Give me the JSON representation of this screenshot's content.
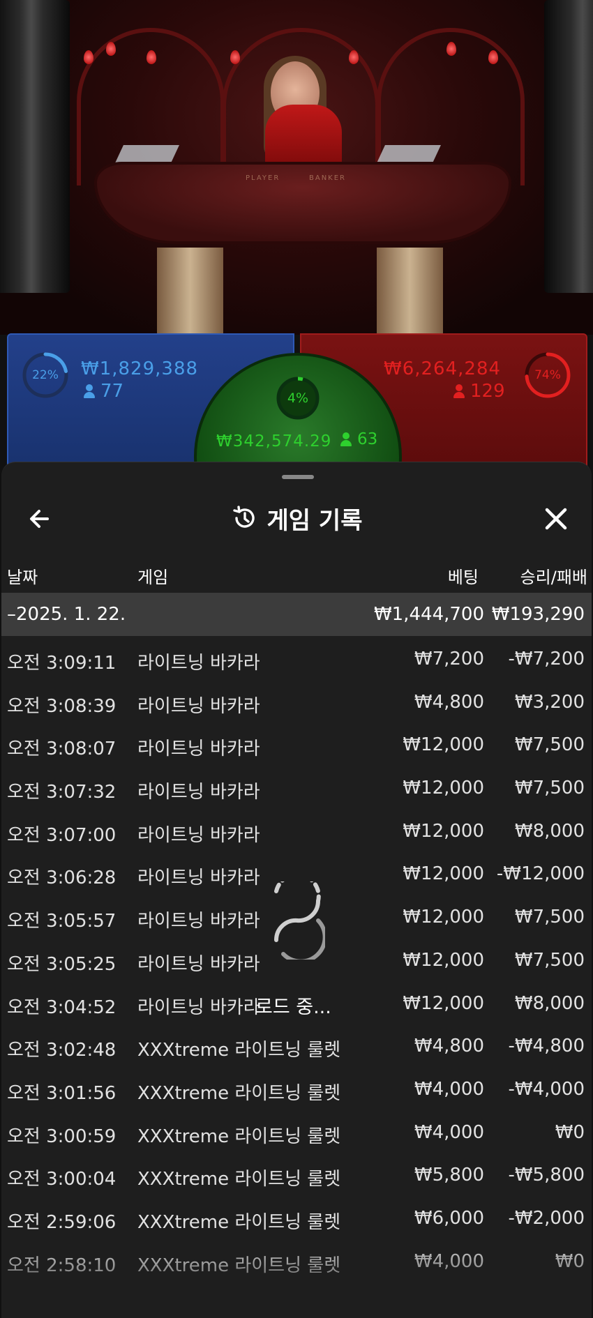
{
  "scene": {
    "table_text_left": "PLAYER",
    "table_text_right": "BANKER"
  },
  "bets": {
    "player": {
      "percent": "22%",
      "percent_value": 22,
      "amount": "₩1,829,388",
      "count": "77",
      "color": "#4a9fe8"
    },
    "banker": {
      "percent": "74%",
      "percent_value": 74,
      "amount": "₩6,264,284",
      "count": "129",
      "color": "#e22020"
    },
    "tie": {
      "percent": "4%",
      "percent_value": 4,
      "amount": "₩342,574.29",
      "count": "63",
      "color": "#2ed02e"
    }
  },
  "sheet": {
    "title": "게임 기록",
    "icons": {
      "back": "arrow-left-icon",
      "history": "history-icon",
      "close": "close-icon"
    },
    "columns": {
      "date": "날짜",
      "game": "게임",
      "bet": "베팅",
      "win_loss": "승리/패배"
    },
    "date_group": {
      "date": "–2025. 1. 22.",
      "bet_total": "₩1,444,700",
      "win_total": "₩193,290"
    },
    "rows": [
      {
        "time": "오전 3:09:11",
        "game": "라이트닝 바카라",
        "bet": "₩7,200",
        "result": "-₩7,200"
      },
      {
        "time": "오전 3:08:39",
        "game": "라이트닝 바카라",
        "bet": "₩4,800",
        "result": "₩3,200"
      },
      {
        "time": "오전 3:08:07",
        "game": "라이트닝 바카라",
        "bet": "₩12,000",
        "result": "₩7,500"
      },
      {
        "time": "오전 3:07:32",
        "game": "라이트닝 바카라",
        "bet": "₩12,000",
        "result": "₩7,500"
      },
      {
        "time": "오전 3:07:00",
        "game": "라이트닝 바카라",
        "bet": "₩12,000",
        "result": "₩8,000"
      },
      {
        "time": "오전 3:06:28",
        "game": "라이트닝 바카라",
        "bet": "₩12,000",
        "result": "-₩12,000"
      },
      {
        "time": "오전 3:05:57",
        "game": "라이트닝 바카라",
        "bet": "₩12,000",
        "result": "₩7,500"
      },
      {
        "time": "오전 3:05:25",
        "game": "라이트닝 바카라",
        "bet": "₩12,000",
        "result": "₩7,500"
      },
      {
        "time": "오전 3:04:52",
        "game": "라이트닝 바카라",
        "bet": "₩12,000",
        "result": "₩8,000"
      },
      {
        "time": "오전 3:02:48",
        "game": "XXXtreme 라이트닝 룰렛",
        "bet": "₩4,800",
        "result": "-₩4,800"
      },
      {
        "time": "오전 3:01:56",
        "game": "XXXtreme 라이트닝 룰렛",
        "bet": "₩4,000",
        "result": "-₩4,000"
      },
      {
        "time": "오전 3:00:59",
        "game": "XXXtreme 라이트닝 룰렛",
        "bet": "₩4,000",
        "result": "₩0"
      },
      {
        "time": "오전 3:00:04",
        "game": "XXXtreme 라이트닝 룰렛",
        "bet": "₩5,800",
        "result": "-₩5,800"
      },
      {
        "time": "오전 2:59:06",
        "game": "XXXtreme 라이트닝 룰렛",
        "bet": "₩6,000",
        "result": "-₩2,000"
      },
      {
        "time": "오전 2:58:10",
        "game": "XXXtreme 라이트닝 룰렛",
        "bet": "₩4,000",
        "result": "₩0"
      }
    ],
    "loading_text": "로드 중..."
  }
}
